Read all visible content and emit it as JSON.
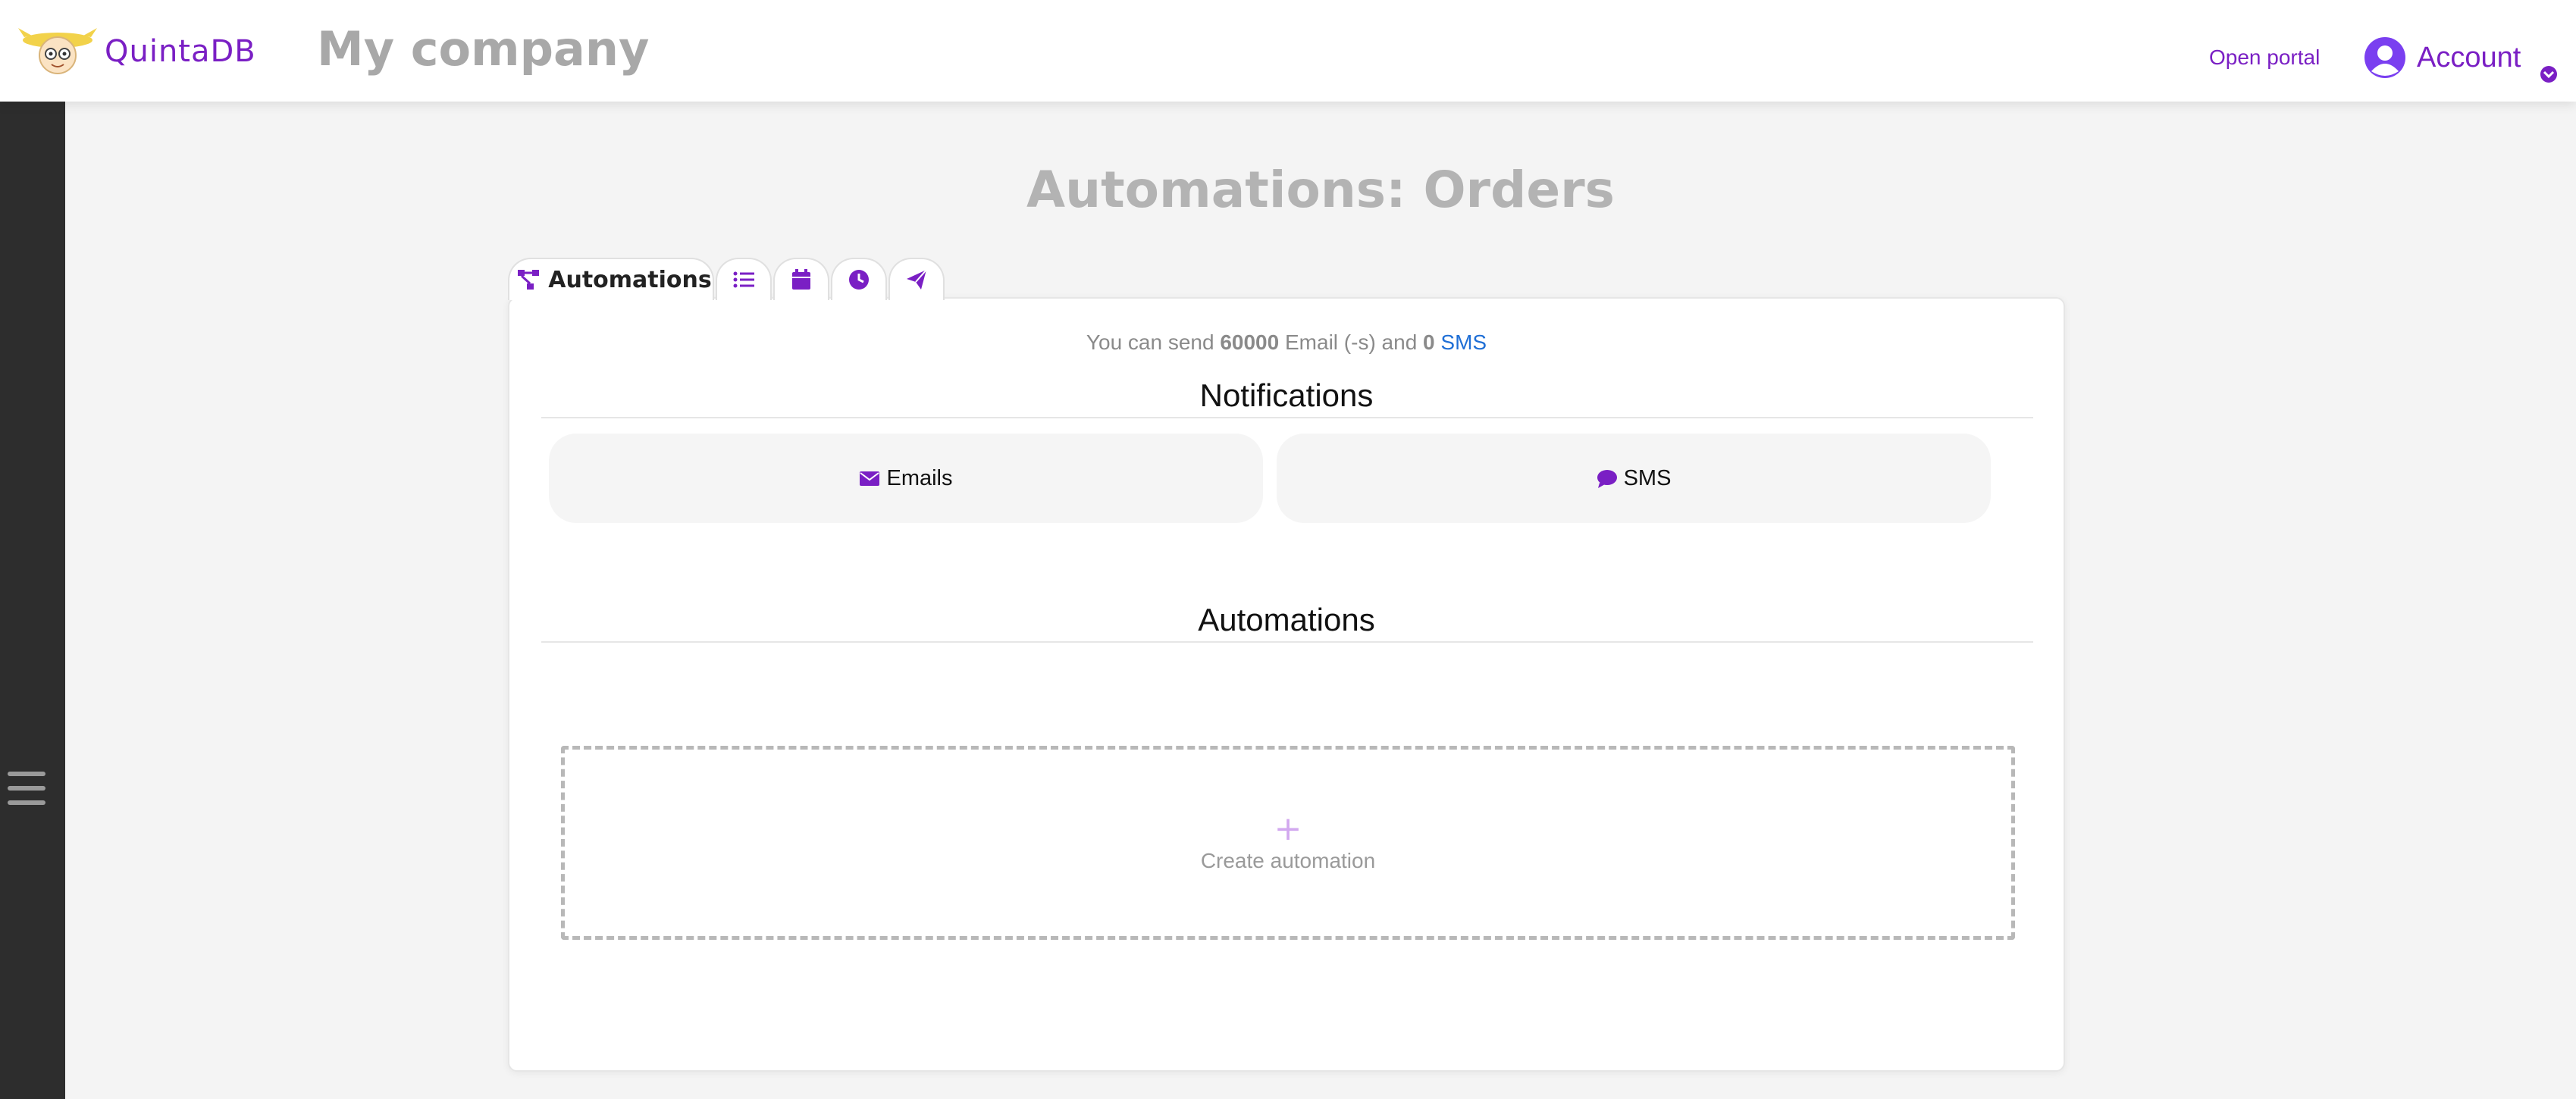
{
  "header": {
    "brand_name": "QuintaDB",
    "company_name": "My company",
    "open_portal_label": "Open portal",
    "account_label": "Account"
  },
  "page": {
    "title": "Automations: Orders"
  },
  "tabs": [
    {
      "label": "Automations",
      "icon": "sitemap-icon",
      "active": true
    },
    {
      "label": "",
      "icon": "list-icon",
      "active": false
    },
    {
      "label": "",
      "icon": "calendar-icon",
      "active": false
    },
    {
      "label": "",
      "icon": "clock-icon",
      "active": false
    },
    {
      "label": "",
      "icon": "paper-plane-icon",
      "active": false
    }
  ],
  "limits": {
    "prefix": "You can send",
    "email_count": "60000",
    "email_unit": "Email (-s) and",
    "sms_count": "0",
    "sms_link": "SMS"
  },
  "notifications": {
    "title": "Notifications",
    "emails_label": "Emails",
    "sms_label": "SMS"
  },
  "automations": {
    "title": "Automations",
    "plus": "+",
    "create_label": "Create automation"
  },
  "colors": {
    "accent": "#7a1fc4",
    "link_blue": "#1f6fd6",
    "sidebar": "#2d2d2d",
    "title_gray": "#b3b3b3"
  }
}
